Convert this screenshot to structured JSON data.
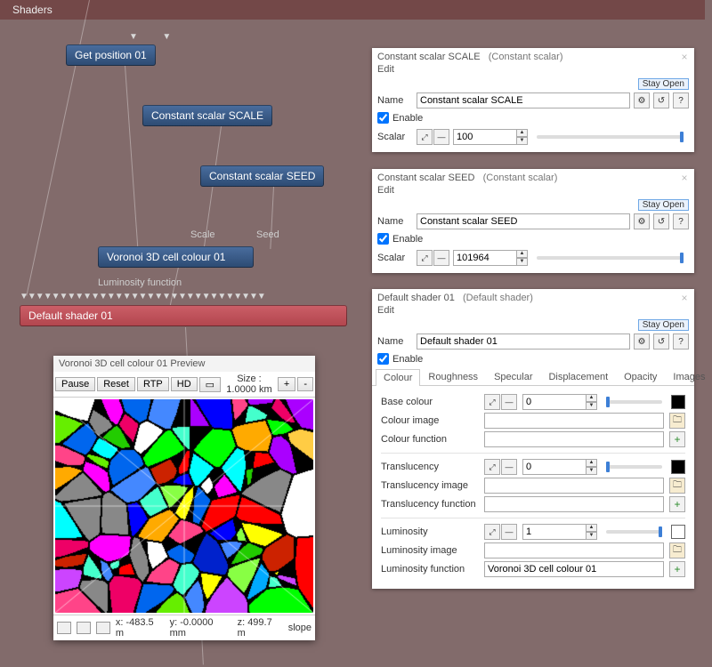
{
  "header": {
    "title": "Shaders"
  },
  "graph": {
    "nodes": {
      "getpos": {
        "label": "Get position 01"
      },
      "scale": {
        "label": "Constant scalar SCALE"
      },
      "seed": {
        "label": "Constant scalar SEED"
      },
      "voronoi": {
        "label": "Voronoi 3D cell colour 01"
      },
      "default": {
        "label": "Default shader 01"
      }
    },
    "ports": {
      "scale": "Scale",
      "seed": "Seed",
      "lumfn": "Luminosity function"
    }
  },
  "preview": {
    "title": "Voronoi 3D cell colour 01 Preview",
    "buttons": {
      "pause": "Pause",
      "reset": "Reset",
      "rtp": "RTP",
      "hd": "HD"
    },
    "size_label": "Size : 1.0000 km",
    "plus": "+",
    "minus": "-",
    "footer": {
      "x": "x: -483.5 m",
      "y": "y: -0.0000 mm",
      "z": "z: 499.7 m",
      "slope": "slope"
    }
  },
  "panels": {
    "scale": {
      "header_name": "Constant scalar SCALE",
      "header_type": "(Constant scalar)",
      "edit": "Edit",
      "stay_open": "Stay Open",
      "name_label": "Name",
      "name_value": "Constant scalar SCALE",
      "enable": "Enable",
      "scalar_label": "Scalar",
      "scalar_value": "100"
    },
    "seed": {
      "header_name": "Constant scalar SEED",
      "header_type": "(Constant scalar)",
      "edit": "Edit",
      "stay_open": "Stay Open",
      "name_label": "Name",
      "name_value": "Constant scalar SEED",
      "enable": "Enable",
      "scalar_label": "Scalar",
      "scalar_value": "101964"
    },
    "default": {
      "header_name": "Default shader 01",
      "header_type": "(Default shader)",
      "edit": "Edit",
      "stay_open": "Stay Open",
      "name_label": "Name",
      "name_value": "Default shader 01",
      "enable": "Enable",
      "tabs": [
        "Colour",
        "Roughness",
        "Specular",
        "Displacement",
        "Opacity",
        "Images"
      ],
      "rows": {
        "base_colour": {
          "label": "Base colour",
          "value": "0"
        },
        "colour_image": {
          "label": "Colour image",
          "value": ""
        },
        "colour_function": {
          "label": "Colour function",
          "value": ""
        },
        "translucency": {
          "label": "Translucency",
          "value": "0"
        },
        "translucency_image": {
          "label": "Translucency image",
          "value": ""
        },
        "translucency_function": {
          "label": "Translucency function",
          "value": ""
        },
        "luminosity": {
          "label": "Luminosity",
          "value": "1"
        },
        "luminosity_image": {
          "label": "Luminosity image",
          "value": ""
        },
        "luminosity_function": {
          "label": "Luminosity function",
          "value": "Voronoi 3D cell colour 01"
        }
      }
    }
  },
  "icons": {
    "gear": "⚙",
    "undo": "↺",
    "help": "?",
    "folder": "🗀",
    "plus": "+",
    "up": "▲",
    "down": "▼",
    "close": "×"
  }
}
